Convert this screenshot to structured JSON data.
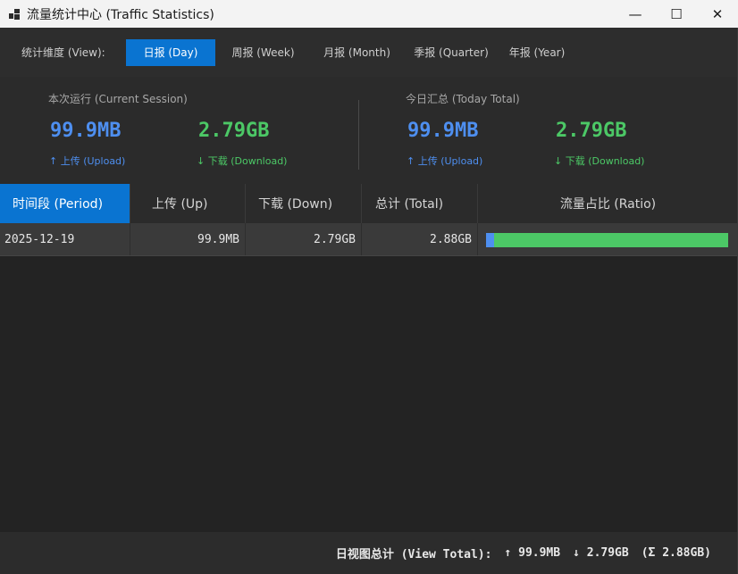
{
  "window": {
    "title": "流量统计中心 (Traffic Statistics)",
    "icon": "app-grid-icon",
    "controls": {
      "minimize": "—",
      "maximize": "☐",
      "close": "✕"
    }
  },
  "viewbar": {
    "label": "统计维度 (View):",
    "tabs": [
      {
        "label": "日报 (Day)",
        "active": true
      },
      {
        "label": "周报 (Week)",
        "active": false
      },
      {
        "label": "月报 (Month)",
        "active": false
      },
      {
        "label": "季报 (Quarter)",
        "active": false
      },
      {
        "label": "年报 (Year)",
        "active": false
      }
    ]
  },
  "summary": {
    "session": {
      "heading": "本次运行 (Current Session)",
      "upload_value": "99.9MB",
      "upload_label": "↑ 上传 (Upload)",
      "download_value": "2.79GB",
      "download_label": "↓ 下载 (Download)"
    },
    "today": {
      "heading": "今日汇总 (Today Total)",
      "upload_value": "99.9MB",
      "upload_label": "↑ 上传 (Upload)",
      "download_value": "2.79GB",
      "download_label": "↓ 下载 (Download)"
    }
  },
  "table": {
    "columns": [
      "时间段 (Period)",
      "上传 (Up)",
      "下载 (Down)",
      "总计 (Total)",
      "流量占比 (Ratio)"
    ],
    "rows": [
      {
        "period": "2025-12-19",
        "up": "99.9MB",
        "down": "2.79GB",
        "total": "2.88GB",
        "up_fraction": 0.034
      }
    ]
  },
  "footer": {
    "label": "日视图总计 (View Total):",
    "up": "↑ 99.9MB",
    "down": "↓ 2.79GB",
    "total": "(Σ 2.88GB)"
  },
  "colors": {
    "accent": "#0a74d1",
    "upload": "#4e8ff0",
    "download": "#4cc866"
  }
}
